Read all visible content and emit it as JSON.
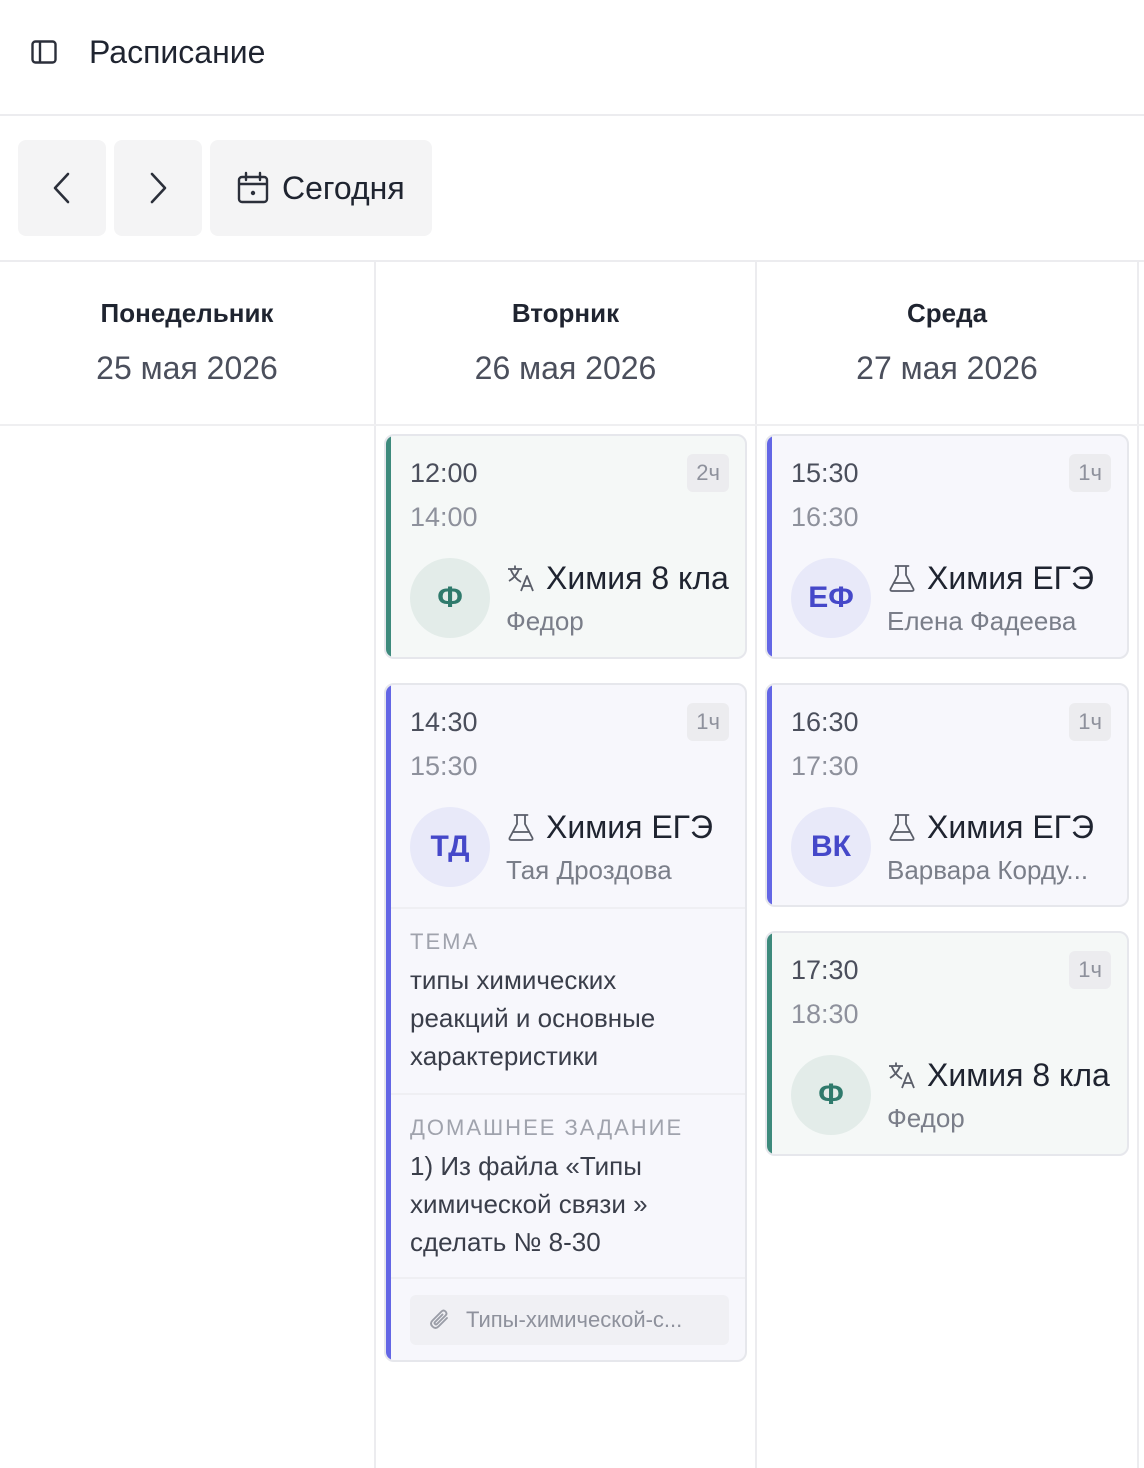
{
  "header": {
    "title": "Расписание",
    "sidebar_icon": "sidebar-toggle-icon"
  },
  "toolbar": {
    "prev_icon": "chevron-left-icon",
    "next_icon": "chevron-right-icon",
    "today_label": "Сегодня",
    "today_icon": "calendar-icon"
  },
  "days": [
    {
      "name": "Понедельник",
      "date": "25 мая 2026"
    },
    {
      "name": "Вторник",
      "date": "26 мая 2026"
    },
    {
      "name": "Среда",
      "date": "27 мая 2026"
    }
  ],
  "lessons": {
    "tue_1": {
      "start": "12:00",
      "end": "14:00",
      "duration": "2ч",
      "initials": "Ф",
      "subject": "Химия 8 кла",
      "subject_icon": "translate-icon",
      "student": "Федор",
      "color": "#3d8a7c"
    },
    "tue_2": {
      "start": "14:30",
      "end": "15:30",
      "duration": "1ч",
      "initials": "ТД",
      "subject": "Химия ЕГЭ",
      "subject_icon": "flask-icon",
      "student": "Тая Дроздова",
      "color": "#6366e5",
      "topic_label": "ТЕМА",
      "topic": "типы химических реакций и основные характеристики",
      "homework_label": "ДОМАШНЕЕ ЗАДАНИЕ",
      "homework": "1) Из файла «Типы химической связи » сделать № 8-30",
      "attachment": "Типы-химической-с...",
      "attachment_icon": "paperclip-icon"
    },
    "wed_1": {
      "start": "15:30",
      "end": "16:30",
      "duration": "1ч",
      "initials": "ЕФ",
      "subject": "Химия ЕГЭ",
      "subject_icon": "flask-icon",
      "student": "Елена Фадеева",
      "color": "#6366e5"
    },
    "wed_2": {
      "start": "16:30",
      "end": "17:30",
      "duration": "1ч",
      "initials": "ВК",
      "subject": "Химия ЕГЭ",
      "subject_icon": "flask-icon",
      "student": "Варвара Корду...",
      "color": "#6366e5"
    },
    "wed_3": {
      "start": "17:30",
      "end": "18:30",
      "duration": "1ч",
      "initials": "Ф",
      "subject": "Химия 8 кла",
      "subject_icon": "translate-icon",
      "student": "Федор",
      "color": "#3d8a7c"
    }
  }
}
